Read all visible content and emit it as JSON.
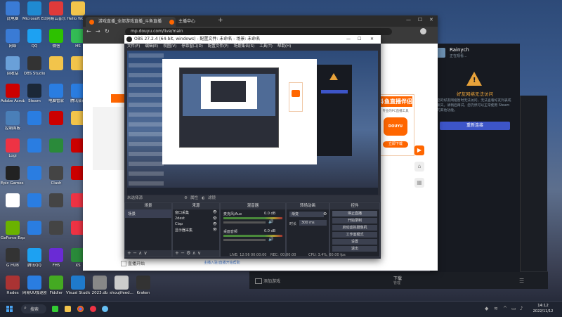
{
  "desktop_icons": [
    {
      "label": "此电脑",
      "color": "#3a7bd5",
      "col": 0,
      "row": 0
    },
    {
      "label": "Microsoft Edge",
      "color": "#1f8ad2",
      "col": 1,
      "row": 0
    },
    {
      "label": "网易云音乐",
      "color": "#e03a3a",
      "col": 2,
      "row": 0
    },
    {
      "label": "Hello World",
      "color": "#f2c44b",
      "col": 3,
      "row": 0
    },
    {
      "label": "网络",
      "color": "#3a7bd5",
      "col": 0,
      "row": 1
    },
    {
      "label": "QQ",
      "color": "#1da1f2",
      "col": 1,
      "row": 1
    },
    {
      "label": "微信",
      "color": "#2dc100",
      "col": 2,
      "row": 1
    },
    {
      "label": "HS",
      "color": "#3b5",
      "col": 3,
      "row": 1
    },
    {
      "label": "回收站",
      "color": "#6aa0d8",
      "col": 0,
      "row": 2
    },
    {
      "label": "OBS Studio",
      "color": "#333",
      "col": 1,
      "row": 2
    },
    {
      "label": "",
      "color": "#f2c44b",
      "col": 2,
      "row": 2
    },
    {
      "label": "",
      "color": "#f2c44b",
      "col": 3,
      "row": 2
    },
    {
      "label": "Adobe Acrobat",
      "color": "#c00",
      "col": 0,
      "row": 3
    },
    {
      "label": "Steam",
      "color": "#1b2838",
      "col": 1,
      "row": 3
    },
    {
      "label": "电脑管家",
      "color": "#2a7de1",
      "col": 2,
      "row": 3
    },
    {
      "label": "腾讯会议",
      "color": "#2a7de1",
      "col": 3,
      "row": 3
    },
    {
      "label": "控制面板",
      "color": "#4a7fb8",
      "col": 0,
      "row": 4
    },
    {
      "label": "",
      "color": "#2a7de1",
      "col": 1,
      "row": 4
    },
    {
      "label": "",
      "color": "#c00",
      "col": 2,
      "row": 4
    },
    {
      "label": "",
      "color": "#f2c44b",
      "col": 3,
      "row": 4
    },
    {
      "label": "Logi",
      "color": "#e34",
      "col": 0,
      "row": 5
    },
    {
      "label": "",
      "color": "#2a7de1",
      "col": 1,
      "row": 5
    },
    {
      "label": "",
      "color": "#2a8a3a",
      "col": 2,
      "row": 5
    },
    {
      "label": "",
      "color": "#c00",
      "col": 3,
      "row": 5
    },
    {
      "label": "Epic Games Launcher",
      "color": "#222",
      "col": 0,
      "row": 6
    },
    {
      "label": "",
      "color": "#2a7de1",
      "col": 1,
      "row": 6
    },
    {
      "label": "Clash",
      "color": "#444",
      "col": 2,
      "row": 6
    },
    {
      "label": "",
      "color": "#c00",
      "col": 3,
      "row": 6
    },
    {
      "label": "",
      "color": "#fff",
      "col": 0,
      "row": 7
    },
    {
      "label": "",
      "color": "#2a7de1",
      "col": 1,
      "row": 7
    },
    {
      "label": "",
      "color": "#444",
      "col": 2,
      "row": 7
    },
    {
      "label": "",
      "color": "#e34",
      "col": 3,
      "row": 7
    },
    {
      "label": "GeForce Experience",
      "color": "#6ab200",
      "col": 0,
      "row": 8
    },
    {
      "label": "",
      "color": "#2a7de1",
      "col": 1,
      "row": 8
    },
    {
      "label": "",
      "color": "#444",
      "col": 2,
      "row": 8
    },
    {
      "label": "",
      "color": "#e34",
      "col": 3,
      "row": 8
    },
    {
      "label": "G HUB",
      "color": "#333",
      "col": 0,
      "row": 9
    },
    {
      "label": "腾讯QQ",
      "color": "#1da1f2",
      "col": 1,
      "row": 9
    },
    {
      "label": "FH5",
      "color": "#6a2bd5",
      "col": 2,
      "row": 9
    },
    {
      "label": "XS",
      "color": "#2a8a3a",
      "col": 3,
      "row": 9
    },
    {
      "label": "Hades",
      "color": "#a33",
      "col": 0,
      "row": 10
    },
    {
      "label": "网易UU加速器",
      "color": "#2a7de1",
      "col": 1,
      "row": 10
    },
    {
      "label": "Fiddler",
      "color": "#4a2",
      "col": 2,
      "row": 10
    },
    {
      "label": "Visual Studio Code",
      "color": "#1f7acc",
      "col": 3,
      "row": 10
    },
    {
      "label": "2023.db",
      "color": "#888",
      "col": 4,
      "row": 10
    },
    {
      "label": "shoujifeed...",
      "color": "#ccc",
      "col": 5,
      "row": 10
    },
    {
      "label": "Kraken",
      "color": "#333",
      "col": 6,
      "row": 10
    }
  ],
  "browser": {
    "tabs": [
      "游戏直播_全部游戏直播_斗鱼直播 - 斗鱼",
      "主播中心"
    ],
    "url": "mp.douyu.com/live/main",
    "promo_title": "斗鱼直播伴侣",
    "promo_sub": "专业的PC直播工具",
    "promo_logo": "DOUYU",
    "promo_btn": "立即下载",
    "live_label": "直播开始",
    "footer_link": "主播入驻/直播开始帮助"
  },
  "obs": {
    "title": "OBS 27.2.4 (64-bit, windows) - 配置文件: 未命名 - 场景: 未命名",
    "menu": [
      "文件(F)",
      "编辑(E)",
      "视图(V)",
      "停靠窗口(D)",
      "配置文件(P)",
      "场景集合(S)",
      "工具(T)",
      "帮助(H)"
    ],
    "no_source": "未选择源",
    "props_btn": "属性",
    "filter_btn": "滤镜",
    "docks": {
      "scenes": {
        "title": "场景",
        "items": [
          "场景"
        ]
      },
      "sources": {
        "title": "来源",
        "items": [
          "窗口采集",
          "2dest",
          "Clap",
          "显示器采集"
        ]
      },
      "mixer": {
        "title": "混音器",
        "tracks": [
          {
            "name": "麦克风/Aux",
            "db": "0.0 dB"
          },
          {
            "name": "桌面音频",
            "db": "0.0 dB"
          }
        ]
      },
      "transitions": {
        "title": "转场动画",
        "type": "渐变",
        "duration_label": "时长",
        "duration": "300 ms"
      },
      "controls": {
        "title": "控件",
        "buttons": [
          "停止直播",
          "开始录制",
          "启动虚拟摄像机",
          "工作室模式",
          "设置",
          "退出"
        ]
      }
    },
    "status": {
      "live": "LIVE: 12:56",
      "live_time": "00:00:00",
      "rec": "REC:",
      "rec_time": "00:00:00",
      "cpu": "CPU: 3.4%, 60.00 fps"
    }
  },
  "steam": {
    "user": "Rainych",
    "user_sub": "正在观看...",
    "warning_title": "好友网络无法访问",
    "warning_body": "您的好友网络暂时无法访问，无法查看好友列表或聊天。请稍后再试。您仍然可以正常使用 Steam 的其他功能。",
    "retry_btn": "重新连接"
  },
  "steam_bottom": {
    "left": "添加游戏",
    "center": "下载",
    "center_sub": "管理"
  },
  "taskbar": {
    "search": "搜索",
    "time": "14:12",
    "date": "2022/11/12"
  }
}
